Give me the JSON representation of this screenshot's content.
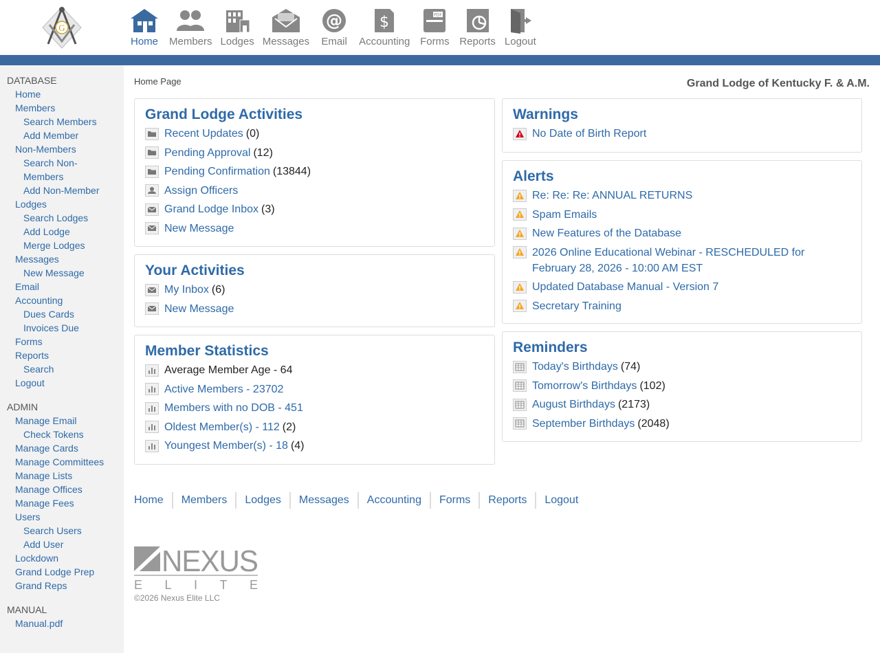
{
  "nav": [
    {
      "label": "Home",
      "icon": "home-icon"
    },
    {
      "label": "Members",
      "icon": "members-icon"
    },
    {
      "label": "Lodges",
      "icon": "lodges-icon"
    },
    {
      "label": "Messages",
      "icon": "messages-icon"
    },
    {
      "label": "Email",
      "icon": "email-icon"
    },
    {
      "label": "Accounting",
      "icon": "accounting-icon"
    },
    {
      "label": "Forms",
      "icon": "forms-icon"
    },
    {
      "label": "Reports",
      "icon": "reports-icon"
    },
    {
      "label": "Logout",
      "icon": "logout-icon"
    }
  ],
  "sidebar": {
    "database_title": "DATABASE",
    "database_items": [
      {
        "label": "Home",
        "level": 1
      },
      {
        "label": "Members",
        "level": 1
      },
      {
        "label": "Search Members",
        "level": 2
      },
      {
        "label": "Add Member",
        "level": 2
      },
      {
        "label": "Non-Members",
        "level": 1
      },
      {
        "label": "Search Non-",
        "level": 2
      },
      {
        "label": "Members",
        "level": 2
      },
      {
        "label": "Add Non-Member",
        "level": 2
      },
      {
        "label": "Lodges",
        "level": 1
      },
      {
        "label": "Search Lodges",
        "level": 2
      },
      {
        "label": "Add Lodge",
        "level": 2
      },
      {
        "label": "Merge Lodges",
        "level": 2
      },
      {
        "label": "Messages",
        "level": 1
      },
      {
        "label": "New Message",
        "level": 2
      },
      {
        "label": "Email",
        "level": 1
      },
      {
        "label": "Accounting",
        "level": 1
      },
      {
        "label": "Dues Cards",
        "level": 2
      },
      {
        "label": "Invoices Due",
        "level": 2
      },
      {
        "label": "Forms",
        "level": 1
      },
      {
        "label": "Reports",
        "level": 1
      },
      {
        "label": "Search",
        "level": 2
      },
      {
        "label": "Logout",
        "level": 1
      }
    ],
    "admin_title": "ADMIN",
    "admin_items": [
      {
        "label": "Manage Email",
        "level": 1
      },
      {
        "label": "Check Tokens",
        "level": 2
      },
      {
        "label": "Manage Cards",
        "level": 1
      },
      {
        "label": "Manage Committees",
        "level": 1
      },
      {
        "label": "Manage Lists",
        "level": 1
      },
      {
        "label": "Manage Offices",
        "level": 1
      },
      {
        "label": "Manage Fees",
        "level": 1
      },
      {
        "label": "Users",
        "level": 1
      },
      {
        "label": "Search Users",
        "level": 2
      },
      {
        "label": "Add User",
        "level": 2
      },
      {
        "label": "Lockdown",
        "level": 1
      },
      {
        "label": "Grand Lodge Prep",
        "level": 1
      },
      {
        "label": "Grand Reps",
        "level": 1
      }
    ],
    "manual_title": "MANUAL",
    "manual_items": [
      {
        "label": "Manual.pdf",
        "level": 1
      }
    ]
  },
  "breadcrumb": "Home Page",
  "org_name": "Grand Lodge of Kentucky F. & A.M.",
  "panels": {
    "grand_lodge": {
      "title": "Grand Lodge Activities",
      "items": [
        {
          "icon": "folder-icon",
          "label": "Recent Updates",
          "count": "(0)"
        },
        {
          "icon": "folder-icon",
          "label": "Pending Approval",
          "count": "(12)"
        },
        {
          "icon": "folder-icon",
          "label": "Pending Confirmation",
          "count": "(13844)"
        },
        {
          "icon": "user-icon",
          "label": "Assign Officers",
          "count": ""
        },
        {
          "icon": "envelope-icon",
          "label": "Grand Lodge Inbox",
          "count": "(3)"
        },
        {
          "icon": "envelope-icon",
          "label": "New Message",
          "count": ""
        }
      ]
    },
    "your": {
      "title": "Your Activities",
      "items": [
        {
          "icon": "envelope-icon",
          "label": "My Inbox",
          "count": "(6)"
        },
        {
          "icon": "envelope-icon",
          "label": "New Message",
          "count": ""
        }
      ]
    },
    "stats": {
      "title": "Member Statistics",
      "items": [
        {
          "icon": "bar-chart-icon",
          "label": "Average Member Age - 64",
          "count": "",
          "plain": true
        },
        {
          "icon": "bar-chart-icon",
          "label": "Active Members - 23702",
          "count": ""
        },
        {
          "icon": "bar-chart-icon",
          "label": "Members with no DOB - 451",
          "count": ""
        },
        {
          "icon": "bar-chart-icon",
          "label": "Oldest Member(s) - 112",
          "count": "(2)"
        },
        {
          "icon": "bar-chart-icon",
          "label": "Youngest Member(s) - 18",
          "count": "(4)"
        }
      ]
    },
    "warnings": {
      "title": "Warnings",
      "items": [
        {
          "icon": "warning-red-icon",
          "label": "No Date of Birth Report",
          "count": ""
        }
      ]
    },
    "alerts": {
      "title": "Alerts",
      "items": [
        {
          "icon": "warning-icon",
          "label": "Re: Re: Re: ANNUAL RETURNS",
          "count": ""
        },
        {
          "icon": "warning-icon",
          "label": "Spam Emails",
          "count": ""
        },
        {
          "icon": "warning-icon",
          "label": "New Features of the Database",
          "count": ""
        },
        {
          "icon": "warning-icon",
          "label": "2026 Online Educational Webinar - RESCHEDULED for February 28, 2026 - 10:00 AM EST",
          "count": ""
        },
        {
          "icon": "warning-icon",
          "label": "Updated Database Manual - Version 7",
          "count": ""
        },
        {
          "icon": "warning-icon",
          "label": "Secretary Training",
          "count": ""
        }
      ]
    },
    "reminders": {
      "title": "Reminders",
      "items": [
        {
          "icon": "calendar-icon",
          "label": "Today's Birthdays",
          "count": "(74)"
        },
        {
          "icon": "calendar-icon",
          "label": "Tomorrow's Birthdays",
          "count": "(102)"
        },
        {
          "icon": "calendar-icon",
          "label": "August Birthdays",
          "count": "(2173)"
        },
        {
          "icon": "calendar-icon",
          "label": "September Birthdays",
          "count": "(2048)"
        }
      ]
    }
  },
  "footer_nav": [
    "Home",
    "Members",
    "Lodges",
    "Messages",
    "Accounting",
    "Forms",
    "Reports",
    "Logout"
  ],
  "brand": {
    "word": "NEXUS",
    "sub": "ELITE"
  },
  "copyright": "©2026 Nexus Elite LLC",
  "colors": {
    "link": "#2f6aa8",
    "bar": "#3a6aa0",
    "sidebar_bg": "#f2f2f2",
    "alert": "#f5a623",
    "danger": "#d0021b"
  }
}
